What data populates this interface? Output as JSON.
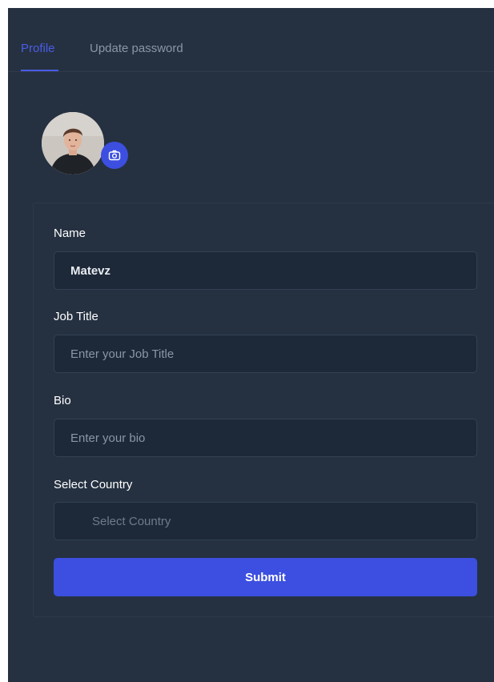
{
  "tabs": [
    {
      "label": "Profile",
      "active": true
    },
    {
      "label": "Update password",
      "active": false
    }
  ],
  "avatar": {
    "icon": "user-photo"
  },
  "camera": {
    "icon": "camera-icon"
  },
  "form": {
    "name": {
      "label": "Name",
      "value": "Matevz"
    },
    "job_title": {
      "label": "Job Title",
      "placeholder": "Enter your Job Title"
    },
    "bio": {
      "label": "Bio",
      "placeholder": "Enter your bio"
    },
    "country": {
      "label": "Select Country",
      "placeholder": "Select Country"
    },
    "submit_label": "Submit"
  },
  "colors": {
    "background": "#253141",
    "accent": "#3c4fe0",
    "input_bg": "#1d2838"
  }
}
